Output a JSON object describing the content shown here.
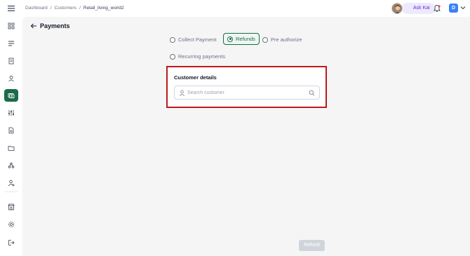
{
  "breadcrumb": {
    "items": [
      "Dashboard",
      "Customers",
      "Retail_living_world2"
    ],
    "separator": "/"
  },
  "header": {
    "ask_kai_label": "Ask Kai",
    "user_initial": "D"
  },
  "page": {
    "title": "Payments"
  },
  "payment_types": [
    {
      "label": "Collect Payment",
      "selected": false
    },
    {
      "label": "Refunds",
      "selected": true
    },
    {
      "label": "Pre authorize",
      "selected": false
    },
    {
      "label": "Recurring payments",
      "selected": false
    }
  ],
  "customer_details": {
    "title": "Customer details",
    "search_placeholder": "Search customer",
    "search_value": ""
  },
  "footer": {
    "refund_label": "Refund"
  },
  "colors": {
    "accent": "#1a6b4a",
    "highlight_border": "#b91c1c",
    "ask_kai_bg": "#ede9fe",
    "user_badge": "#3b82f6"
  },
  "sidebar": {
    "icons": [
      "dashboard-icon",
      "list-icon",
      "document-icon",
      "user-icon",
      "payments-icon",
      "sliders-icon",
      "file-search-icon",
      "folder-icon",
      "network-icon",
      "user-settings-icon",
      "store-icon",
      "settings-icon",
      "logout-icon"
    ],
    "active": "payments-icon"
  }
}
